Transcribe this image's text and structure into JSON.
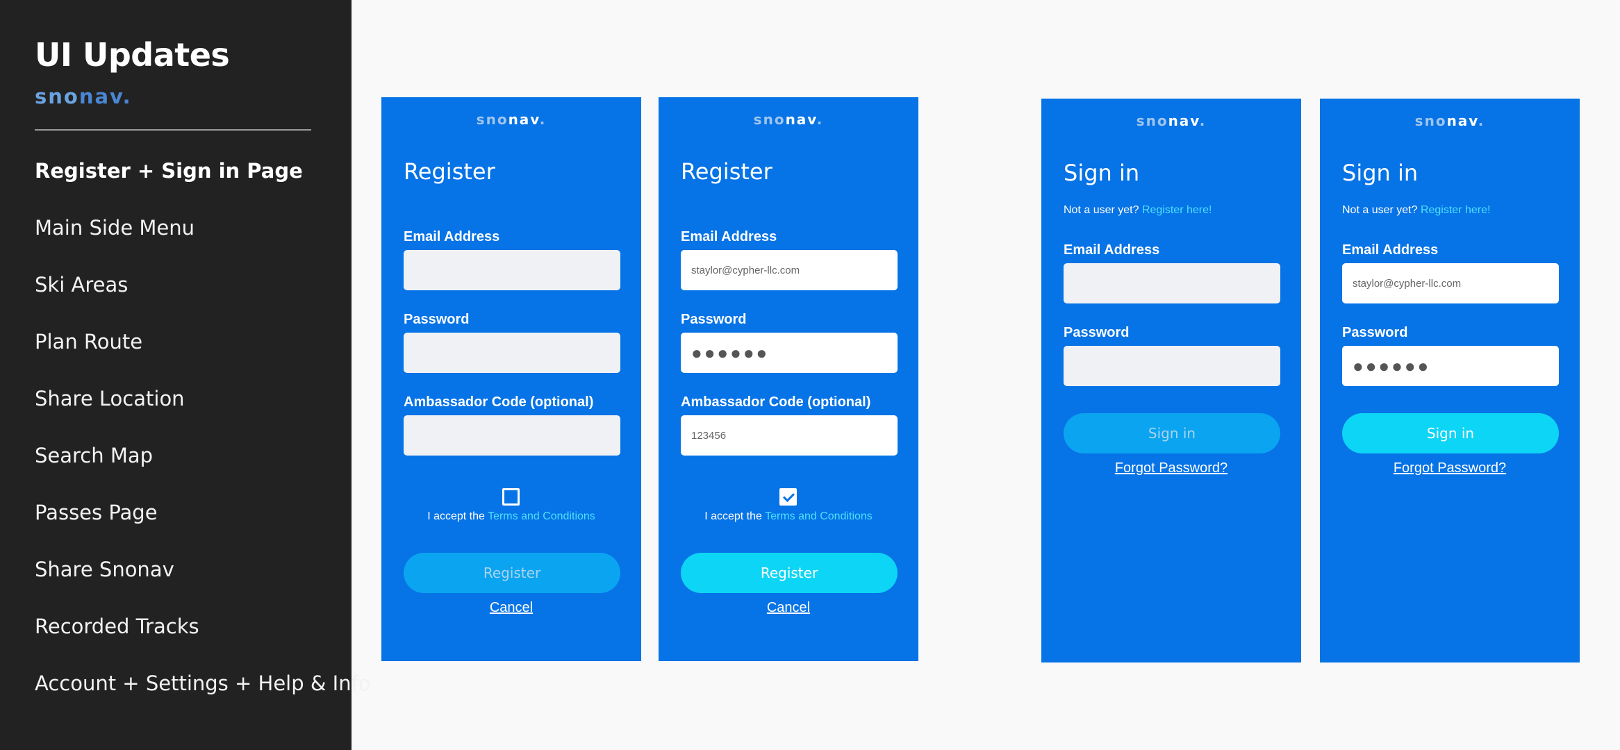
{
  "sidebar": {
    "title": "UI Updates",
    "logo": {
      "part1": "sno",
      "part2": "nav",
      "dot": "."
    },
    "items": [
      {
        "label": "Register + Sign in Page"
      },
      {
        "label": "Main Side Menu"
      },
      {
        "label": "Ski Areas"
      },
      {
        "label": "Plan Route"
      },
      {
        "label": "Share Location"
      },
      {
        "label": "Search Map"
      },
      {
        "label": "Passes Page"
      },
      {
        "label": "Share Snonav"
      },
      {
        "label": "Recorded Tracks"
      },
      {
        "label": "Account + Settings + Help & Info"
      }
    ]
  },
  "colors": {
    "sidebar_bg": "#222222",
    "phone_bg": "#0673e6",
    "button_disabled": "#0ba4f0",
    "button_enabled": "#0dd5f5",
    "link": "#4fe0ff",
    "field_empty": "#eff1f4",
    "page_bg": "#f9f9f9"
  },
  "register_empty": {
    "logo": {
      "part1": "sno",
      "part2": "nav",
      "dot": "."
    },
    "title": "Register",
    "email_label": "Email Address",
    "email_value": "",
    "password_label": "Password",
    "password_value": "",
    "code_label": "Ambassador Code (optional)",
    "code_value": "",
    "accept_text": "I accept the",
    "terms_link": "Terms and Conditions",
    "terms_checked": false,
    "submit_label": "Register",
    "cancel_label": "Cancel"
  },
  "register_filled": {
    "logo": {
      "part1": "sno",
      "part2": "nav",
      "dot": "."
    },
    "title": "Register",
    "email_label": "Email Address",
    "email_value": "staylor@cypher-llc.com",
    "password_label": "Password",
    "password_value": "●●●●●●",
    "code_label": "Ambassador Code (optional)",
    "code_value": "123456",
    "accept_text": "I accept the",
    "terms_link": "Terms and Conditions",
    "terms_checked": true,
    "submit_label": "Register",
    "cancel_label": "Cancel"
  },
  "signin_empty": {
    "logo": {
      "part1": "sno",
      "part2": "nav",
      "dot": "."
    },
    "title": "Sign in",
    "subtitle": "Not a user yet?",
    "register_link": "Register here!",
    "email_label": "Email Address",
    "email_value": "",
    "password_label": "Password",
    "password_value": "",
    "submit_label": "Sign in",
    "forgot_label": "Forgot Password?"
  },
  "signin_filled": {
    "logo": {
      "part1": "sno",
      "part2": "nav",
      "dot": "."
    },
    "title": "Sign in",
    "subtitle": "Not a user yet?",
    "register_link": "Register here!",
    "email_label": "Email Address",
    "email_value": "staylor@cypher-llc.com",
    "password_label": "Password",
    "password_value": "●●●●●●",
    "submit_label": "Sign in",
    "forgot_label": "Forgot Password?"
  }
}
